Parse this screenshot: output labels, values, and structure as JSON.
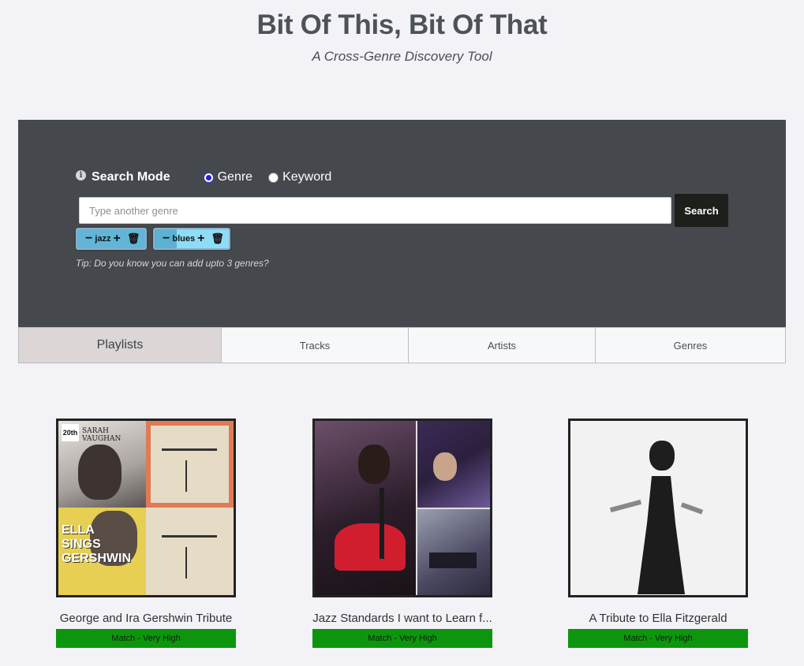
{
  "header": {
    "title": "Bit Of This, Bit Of That",
    "subtitle": "A Cross-Genre Discovery Tool"
  },
  "search": {
    "mode_label": "Search Mode",
    "modes": [
      "Genre",
      "Keyword"
    ],
    "selected_mode": "Genre",
    "input_value": "",
    "placeholder": "Type another genre",
    "button_label": "Search",
    "chips": [
      {
        "label": "jazz",
        "color": "#62b5d7"
      },
      {
        "label": "blues",
        "color": "#8fdcf6"
      }
    ],
    "tip": "Tip: Do you know you can add upto 3 genres?"
  },
  "tabs": [
    {
      "label": "Playlists",
      "active": true
    },
    {
      "label": "Tracks",
      "active": false
    },
    {
      "label": "Artists",
      "active": false
    },
    {
      "label": "Genres",
      "active": false
    }
  ],
  "playlists": [
    {
      "title": "George and Ira Gershwin Tribute",
      "match": "Match - Very High",
      "art_text": [
        "20th",
        "SARAH VAUGHAN",
        "ELLA SINGS GERSHWIN"
      ]
    },
    {
      "title": "Jazz Standards I want to Learn f...",
      "match": "Match - Very High"
    },
    {
      "title": "A Tribute to Ella Fitzgerald",
      "match": "Match - Very High"
    }
  ],
  "colors": {
    "panel": "#45484c",
    "match_badge": "#0d960d",
    "search_button": "#1c1f1a",
    "active_tab": "#dcd6d7"
  },
  "icons": {
    "info": "info-icon",
    "chip_minus": "minus-icon",
    "chip_plus": "plus-icon",
    "chip_delete": "trash-icon"
  }
}
